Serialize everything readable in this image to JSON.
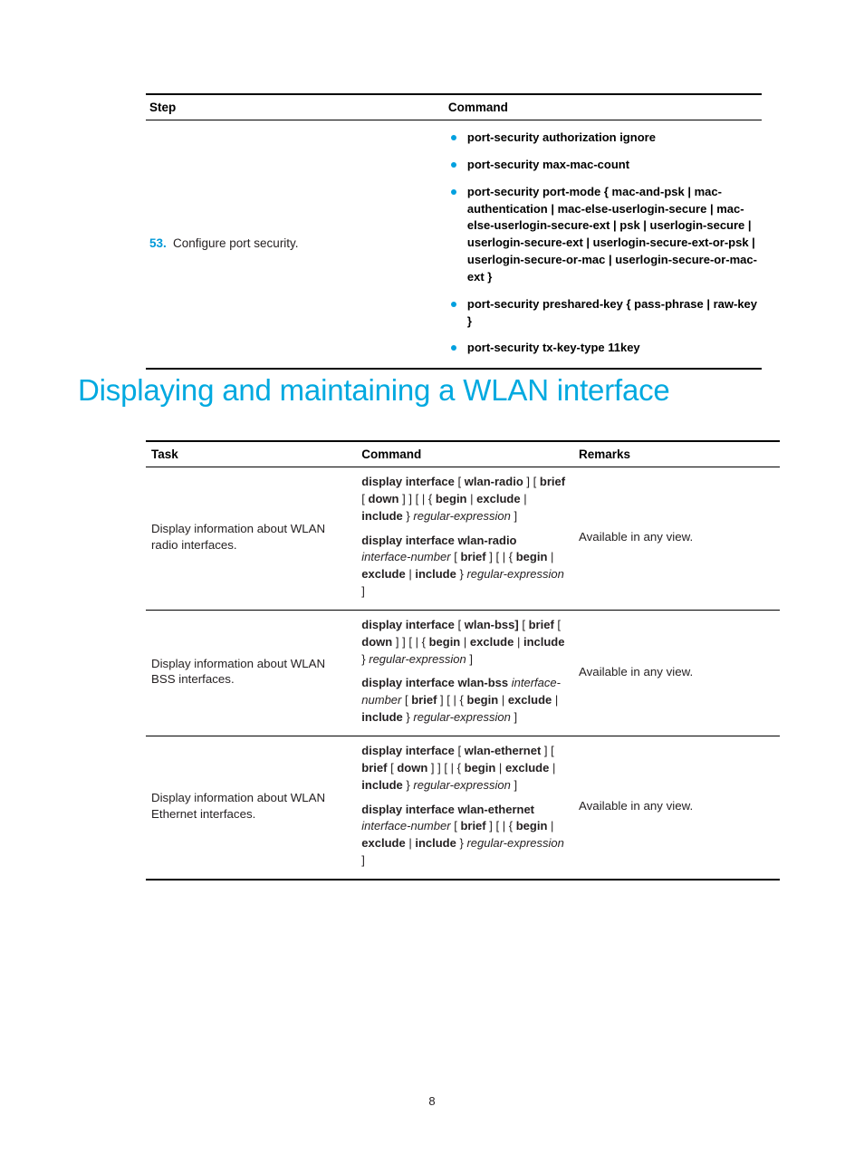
{
  "step_table": {
    "headers": {
      "step": "Step",
      "command": "Command"
    },
    "row": {
      "number": "53.",
      "task": "Configure port security.",
      "commands": [
        "port-security authorization ignore",
        "port-security max-mac-count",
        "port-security port-mode { mac-and-psk | mac-authentication | mac-else-userlogin-secure | mac-else-userlogin-secure-ext | psk | userlogin-secure | userlogin-secure-ext | userlogin-secure-ext-or-psk | userlogin-secure-or-mac | userlogin-secure-or-mac-ext }",
        "port-security preshared-key { pass-phrase | raw-key }",
        "port-security tx-key-type 11key"
      ]
    }
  },
  "heading": "Displaying and maintaining a WLAN interface",
  "task_table": {
    "headers": {
      "task": "Task",
      "command": "Command",
      "remarks": "Remarks"
    },
    "rows": [
      {
        "task": "Display information about WLAN radio interfaces.",
        "command_1_bold_a": "display interface",
        "command_1_rest": "[ wlan-radio ] [ brief [ down ] ] [ | { begin | exclude | include } regular-expression ]",
        "command_2_bold": "display interface wlan-radio",
        "command_2_rest": "interface-number [ brief ] [ | { begin | exclude | include } regular-expression ]",
        "remarks": "Available in any view."
      },
      {
        "task": "Display information about WLAN BSS interfaces.",
        "command_1_bold_a": "display interface",
        "command_1_rest": "[ wlan-bss] [ brief [ down ] ] [ | { begin | exclude | include } regular-expression ]",
        "command_2_bold": "display interface wlan-bss",
        "command_2_rest": "interface-number [ brief ] [ | { begin | exclude | include } regular-expression ]",
        "remarks": "Available in any view."
      },
      {
        "task": "Display information about WLAN Ethernet interfaces.",
        "command_1_bold_a": "display interface",
        "command_1_rest": "[ wlan-ethernet ] [ brief [ down ] ] [ | { begin | exclude | include } regular-expression ]",
        "command_2_bold": "display interface wlan-ethernet",
        "command_2_rest": "interface-number [ brief ] [ | { begin | exclude | include } regular-expression ]",
        "remarks": "Available in any view."
      }
    ]
  },
  "footer": {
    "page_number": "8"
  },
  "colors": {
    "accent": "#00a9e0",
    "bullet": "#00a0df",
    "step_number": "#0099d8"
  }
}
